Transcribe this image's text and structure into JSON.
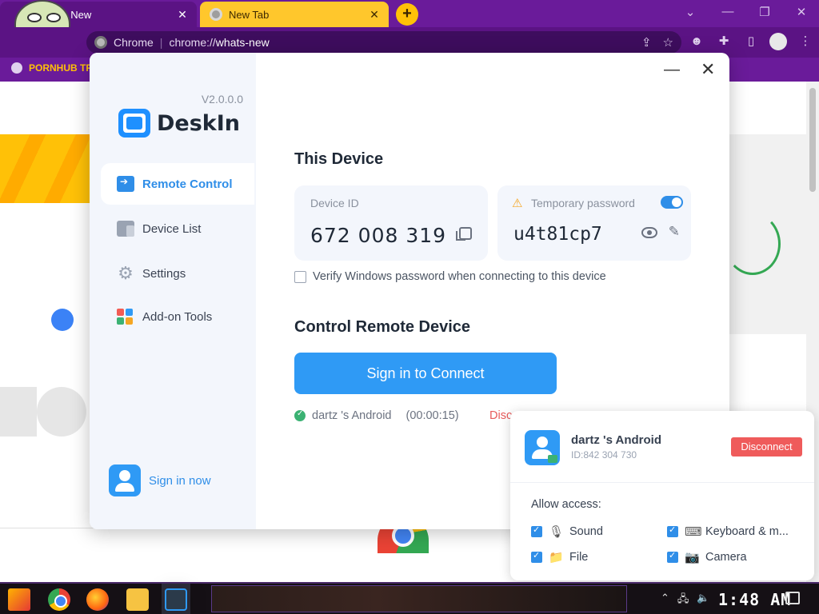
{
  "browser": {
    "tabs": [
      {
        "label": "t's New",
        "close": "✕"
      },
      {
        "label": "New Tab",
        "close": "✕"
      }
    ],
    "new_tab": "+",
    "window_controls": {
      "dropdown": "⌄",
      "minimize": "—",
      "restore": "❐",
      "close": "✕"
    },
    "omnibox": {
      "site": "Chrome",
      "separator": "|",
      "url_prefix": "chrome://",
      "url_path": "whats-new"
    },
    "bookmark": "PORNHUB TR"
  },
  "deskin": {
    "version": "V2.0.0.0",
    "brand": "DeskIn",
    "nav": [
      {
        "label": "Remote Control",
        "icon": "remote-control-icon",
        "active": true
      },
      {
        "label": "Device List",
        "icon": "device-list-icon",
        "active": false
      },
      {
        "label": "Settings",
        "icon": "gear-icon",
        "active": false
      },
      {
        "label": "Add-on Tools",
        "icon": "addon-tools-icon",
        "active": false
      }
    ],
    "sign_in_now": "Sign in now",
    "window": {
      "minimize": "—",
      "close": "✕"
    },
    "this_device": {
      "heading": "This Device",
      "device_id_label": "Device ID",
      "device_id": "672 008 319",
      "password_label": "Temporary password",
      "password": "u4t81cp7",
      "password_toggle_on": true,
      "verify_label": "Verify Windows password when connecting to this device",
      "verify_checked": false
    },
    "control_remote": {
      "heading": "Control Remote Device",
      "connect_button": "Sign in to Connect",
      "session_device": "dartz 's Android",
      "session_time": "(00:00:15)",
      "disconnect_link": "Disc"
    },
    "side_tab": "›"
  },
  "connection_panel": {
    "device_name": "dartz 's Android",
    "device_id": "ID:842 304 730",
    "disconnect_button": "Disconnect",
    "allow_label": "Allow access:",
    "permissions": [
      {
        "label": "Sound",
        "icon": "microphone-icon",
        "checked": true
      },
      {
        "label": "Keyboard & m...",
        "icon": "keyboard-icon",
        "checked": true
      },
      {
        "label": "File",
        "icon": "folder-icon",
        "checked": true
      },
      {
        "label": "Camera",
        "icon": "camera-icon",
        "checked": true
      }
    ]
  },
  "taskbar": {
    "clock": "1:48 AM"
  },
  "colors": {
    "accent_blue": "#2f9af5",
    "danger_red": "#ef5b5b",
    "chrome_theme": "#6a1b9a",
    "new_tab_yellow": "#ffc72c"
  }
}
